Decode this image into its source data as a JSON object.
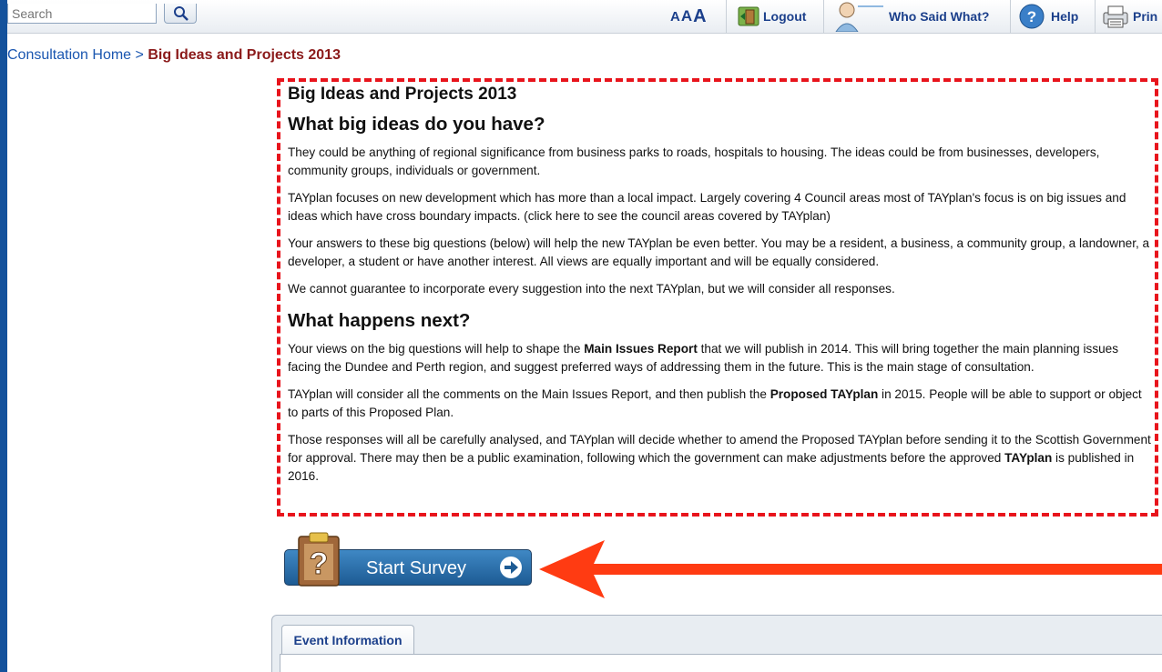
{
  "toolbar": {
    "search_placeholder": "Search",
    "text_size_label": [
      "A",
      "A",
      "A"
    ],
    "logout_label": "Logout",
    "who_said_label": "Who Said What?",
    "help_label": "Help",
    "print_label": "Prin"
  },
  "breadcrumb": {
    "home_label": "Consultation Home",
    "separator": ">",
    "current_label": "Big Ideas and Projects 2013"
  },
  "content": {
    "title": "Big Ideas and Projects 2013",
    "heading1": "What big ideas do you have?",
    "para1": "They could be anything of regional significance from business parks to roads, hospitals to housing. The ideas could be from businesses, developers, community groups, individuals or government.",
    "para2": "TAYplan focuses on new development which has more than a local impact. Largely covering 4 Council areas most of TAYplan's focus is on big issues and ideas which have cross boundary impacts. (click here to see the council areas covered by TAYplan)",
    "para3": "Your answers to these big questions (below) will help the new TAYplan be even better. You may be a resident, a business, a community group, a landowner, a developer, a student or have another interest. All views are equally important and will be equally considered.",
    "para4": "We cannot guarantee to incorporate every suggestion into the next TAYplan, but we will consider all responses.",
    "heading2": "What happens next?",
    "para5_a": "Your views on the big questions will help to shape the ",
    "para5_bold": "Main Issues Report",
    "para5_b": " that we will publish in 2014. This will bring together the main planning issues facing the Dundee and Perth region, and suggest preferred ways of addressing them in the future. This is the main stage of consultation.",
    "para6_a": "TAYplan will consider all the comments on the Main Issues Report, and then publish the ",
    "para6_bold": "Proposed TAYplan",
    "para6_b": " in 2015. People will be able to support or object to parts of this Proposed Plan.",
    "para7_a": "Those responses will all be carefully analysed, and TAYplan will decide whether to amend the Proposed TAYplan before sending it to the Scottish Government for approval. There may then be a public examination, following which the government can make adjustments before the approved ",
    "para7_bold": "TAYplan",
    "para7_b": " is published in 2016."
  },
  "start_survey": {
    "label": "Start Survey"
  },
  "tabs": [
    {
      "label": "Event Information"
    }
  ],
  "colors": {
    "page_background": "#14529c",
    "highlight_border": "#e8141c",
    "annotation_arrow": "#ff3b12",
    "breadcrumb_current": "#8b1a1a",
    "link": "#1a56b0"
  },
  "icons": [
    "search-icon",
    "logout-door-icon",
    "user-speech-icon",
    "help-icon",
    "print-icon",
    "clipboard-question-icon",
    "arrow-right-circle-icon"
  ]
}
